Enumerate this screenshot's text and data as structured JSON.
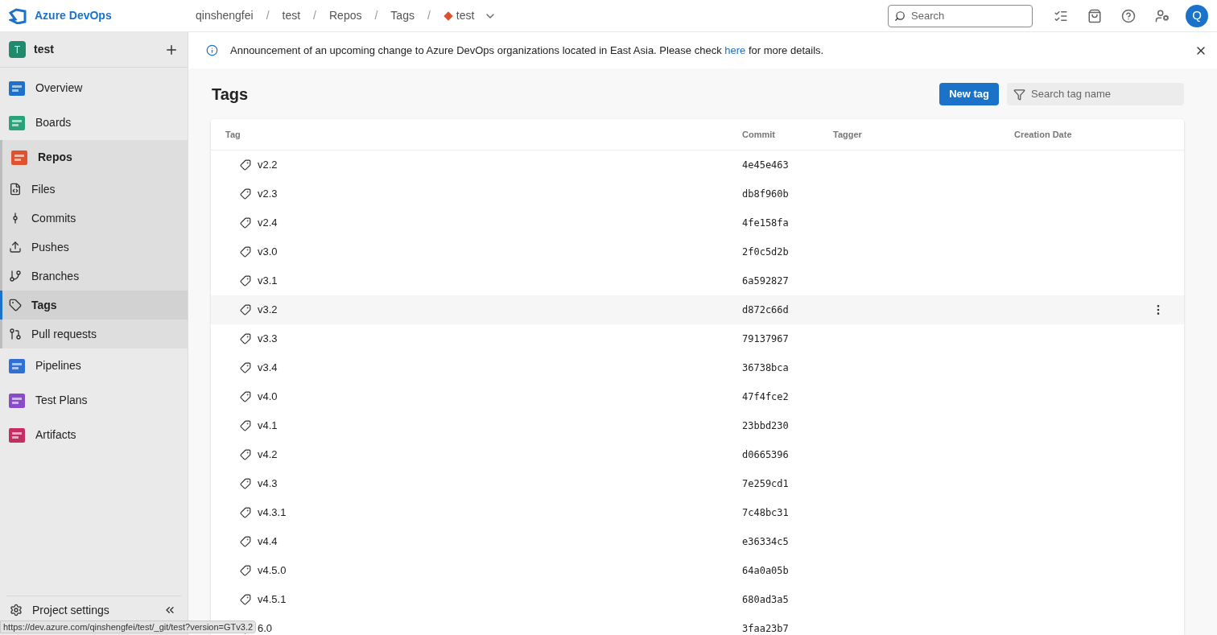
{
  "header": {
    "product": "Azure DevOps",
    "breadcrumbs": [
      "qinshengfei",
      "test",
      "Repos",
      "Tags"
    ],
    "separator": "/",
    "repo": "test",
    "search": {
      "placeholder": "Search"
    },
    "avatar": "Q"
  },
  "project": {
    "initial": "T",
    "name": "test"
  },
  "sidebar": {
    "items": [
      {
        "label": "Overview",
        "selected": false
      },
      {
        "label": "Boards",
        "selected": false
      },
      {
        "label": "Repos",
        "expanded": true,
        "children": [
          {
            "label": "Files",
            "selected": false
          },
          {
            "label": "Commits",
            "selected": false
          },
          {
            "label": "Pushes",
            "selected": false
          },
          {
            "label": "Branches",
            "selected": false
          },
          {
            "label": "Tags",
            "selected": true
          },
          {
            "label": "Pull requests",
            "selected": false
          }
        ]
      },
      {
        "label": "Pipelines",
        "selected": false
      },
      {
        "label": "Test Plans",
        "selected": false
      },
      {
        "label": "Artifacts",
        "selected": false
      }
    ],
    "footer": "Project settings"
  },
  "announcement": {
    "text": "Announcement of an upcoming change to Azure DevOps organizations located in East Asia. Please check",
    "link": "here",
    "after": "for more details."
  },
  "page": {
    "title": "Tags",
    "new_button": "New tag",
    "filter": {
      "placeholder": "Search tag name"
    }
  },
  "table": {
    "columns": [
      "Tag",
      "Commit",
      "Tagger",
      "Creation Date"
    ],
    "rows": [
      {
        "tag": "v2.2",
        "commit": "4e45e463",
        "hovered": false
      },
      {
        "tag": "v2.3",
        "commit": "db8f960b",
        "hovered": false
      },
      {
        "tag": "v2.4",
        "commit": "4fe158fa",
        "hovered": false
      },
      {
        "tag": "v3.0",
        "commit": "2f0c5d2b",
        "hovered": false
      },
      {
        "tag": "v3.1",
        "commit": "6a592827",
        "hovered": false
      },
      {
        "tag": "v3.2",
        "commit": "d872c66d",
        "hovered": true
      },
      {
        "tag": "v3.3",
        "commit": "79137967",
        "hovered": false
      },
      {
        "tag": "v3.4",
        "commit": "36738bca",
        "hovered": false
      },
      {
        "tag": "v4.0",
        "commit": "47f4fce2",
        "hovered": false
      },
      {
        "tag": "v4.1",
        "commit": "23bbd230",
        "hovered": false
      },
      {
        "tag": "v4.2",
        "commit": "d0665396",
        "hovered": false
      },
      {
        "tag": "v4.3",
        "commit": "7e259cd1",
        "hovered": false
      },
      {
        "tag": "v4.3.1",
        "commit": "7c48bc31",
        "hovered": false
      },
      {
        "tag": "v4.4",
        "commit": "e36334c5",
        "hovered": false
      },
      {
        "tag": "v4.5.0",
        "commit": "64a0a05b",
        "hovered": false
      },
      {
        "tag": "v4.5.1",
        "commit": "680ad3a5",
        "hovered": false
      },
      {
        "tag": "6.0",
        "commit": "3faa23b7",
        "hovered": false
      }
    ]
  },
  "status_url": "https://dev.azure.com/qinshengfei/test/_git/test?version=GTv3.2"
}
